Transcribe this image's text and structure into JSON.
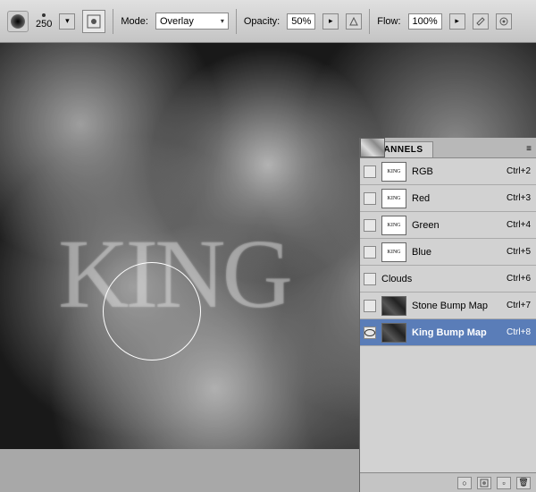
{
  "toolbar": {
    "brush_size": "250",
    "mode_label": "Mode:",
    "mode_value": "Overlay",
    "opacity_label": "Opacity:",
    "opacity_value": "50%",
    "flow_label": "Flow:",
    "flow_value": "100%"
  },
  "canvas": {
    "text": "KING"
  },
  "panel": {
    "tab": "CHANNELS",
    "channels": [
      {
        "name": "RGB",
        "shortcut": "Ctrl+2",
        "thumb": "king",
        "visible": false,
        "selected": false
      },
      {
        "name": "Red",
        "shortcut": "Ctrl+3",
        "thumb": "king",
        "visible": false,
        "selected": false
      },
      {
        "name": "Green",
        "shortcut": "Ctrl+4",
        "thumb": "king",
        "visible": false,
        "selected": false
      },
      {
        "name": "Blue",
        "shortcut": "Ctrl+5",
        "thumb": "king",
        "visible": false,
        "selected": false
      },
      {
        "name": "Clouds",
        "shortcut": "Ctrl+6",
        "thumb": "clouds",
        "visible": false,
        "selected": false
      },
      {
        "name": "Stone Bump Map",
        "shortcut": "Ctrl+7",
        "thumb": "dark",
        "visible": false,
        "selected": false
      },
      {
        "name": "King Bump Map",
        "shortcut": "Ctrl+8",
        "thumb": "dark",
        "visible": true,
        "selected": true
      }
    ]
  },
  "icons": {
    "dropdown": "▾",
    "play": "▸",
    "menu": "≡",
    "circle": "○",
    "new": "▫",
    "trash": "🗑"
  }
}
